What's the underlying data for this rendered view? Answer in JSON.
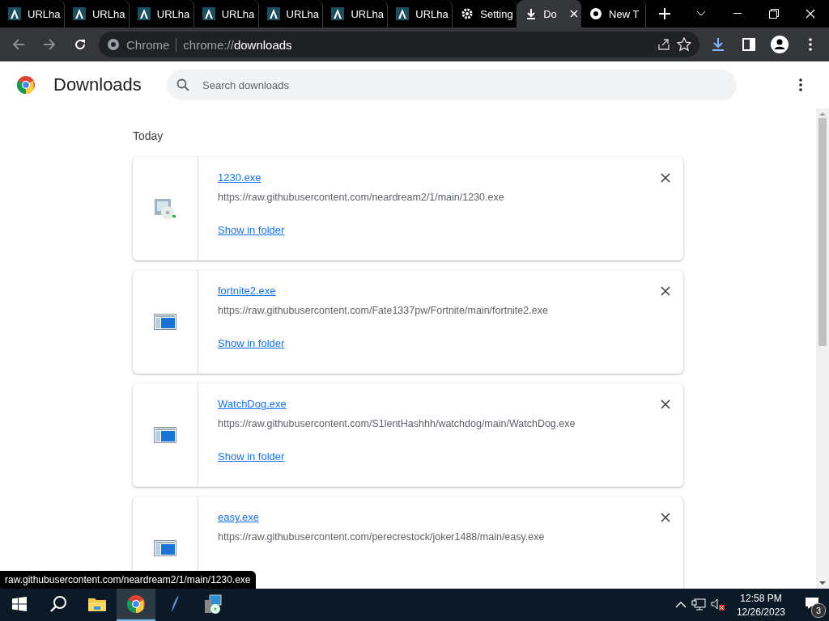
{
  "tabs": [
    {
      "title": "URLha",
      "kind": "app",
      "selected": false
    },
    {
      "title": "URLha",
      "kind": "app",
      "selected": false
    },
    {
      "title": "URLha",
      "kind": "app",
      "selected": false
    },
    {
      "title": "URLha",
      "kind": "app",
      "selected": false
    },
    {
      "title": "URLha",
      "kind": "app",
      "selected": false
    },
    {
      "title": "URLha",
      "kind": "app",
      "selected": false
    },
    {
      "title": "URLha",
      "kind": "app",
      "selected": false
    },
    {
      "title": "Setting",
      "kind": "settings",
      "selected": false
    },
    {
      "title": "Do",
      "kind": "download",
      "selected": true
    },
    {
      "title": "New T",
      "kind": "chrome",
      "selected": false
    }
  ],
  "address": {
    "origin": "Chrome",
    "scheme": "chrome://",
    "path": "downloads"
  },
  "page": {
    "title": "Downloads",
    "search_placeholder": "Search downloads",
    "section": "Today"
  },
  "downloads": [
    {
      "name": "1230.exe",
      "url": "https://raw.githubusercontent.com/neardream2/1/main/1230.exe",
      "action": "Show in folder",
      "kind": "installer"
    },
    {
      "name": "fortnite2.exe",
      "url": "https://raw.githubusercontent.com/Fate1337pw/Fortnite/main/fortnite2.exe",
      "action": "Show in folder",
      "kind": "window"
    },
    {
      "name": "WatchDog.exe",
      "url": "https://raw.githubusercontent.com/S1lentHashhh/watchdog/main/WatchDog.exe",
      "action": "Show in folder",
      "kind": "window"
    },
    {
      "name": "easy.exe",
      "url": "https://raw.githubusercontent.com/perecrestock/joker1488/main/easy.exe",
      "kind": "window"
    }
  ],
  "status_bubble": "raw.githubusercontent.com/neardream2/1/main/1230.exe",
  "taskbar": {
    "apps": [
      {
        "kind": "explorer",
        "selected": false
      },
      {
        "kind": "chrome",
        "selected": true
      },
      {
        "kind": "feather",
        "selected": false
      },
      {
        "kind": "installer",
        "selected": false
      }
    ],
    "time": "12:58 PM",
    "date": "12/26/2023",
    "notifications": "3"
  }
}
